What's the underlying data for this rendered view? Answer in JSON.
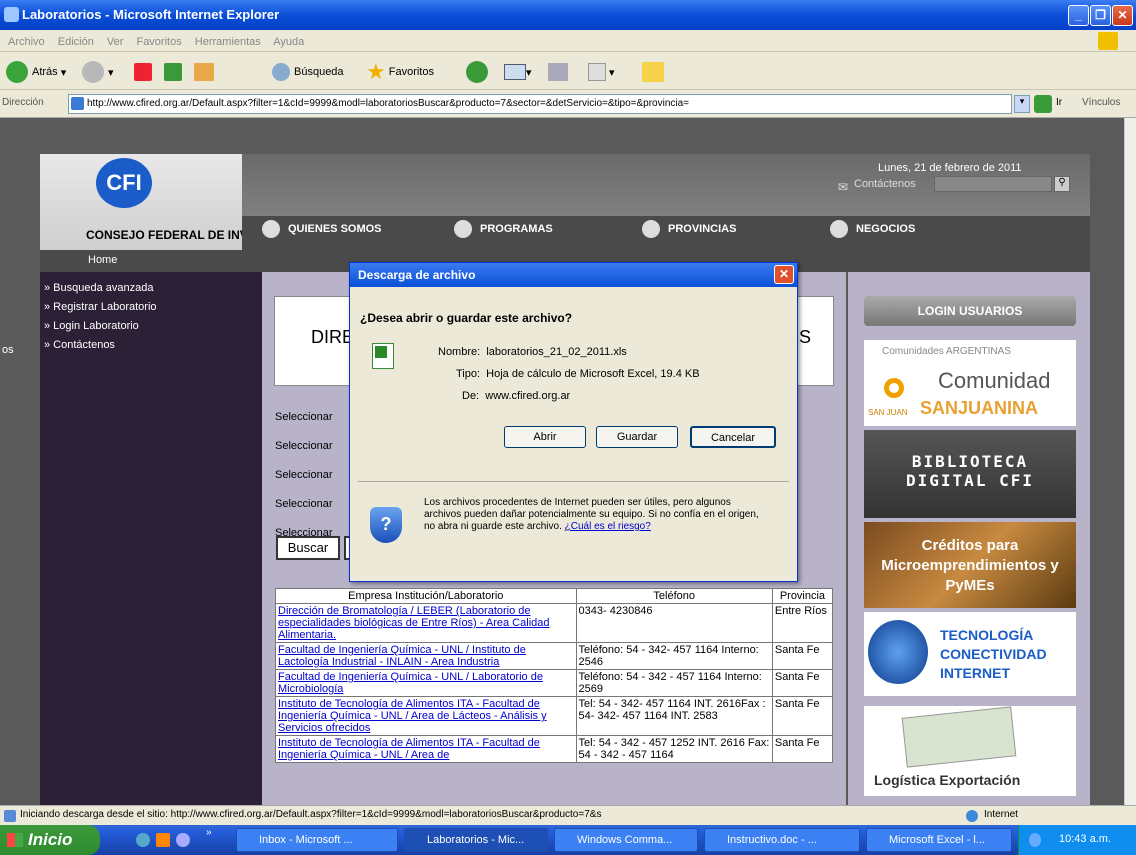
{
  "window": {
    "title": "Laboratorios - Microsoft Internet Explorer"
  },
  "menu": [
    "Archivo",
    "Edición",
    "Ver",
    "Favoritos",
    "Herramientas",
    "Ayuda"
  ],
  "toolbar": {
    "back": "Atrás",
    "search": "Búsqueda",
    "favorites": "Favoritos"
  },
  "address": {
    "label": "Dirección",
    "url": "http://www.cfired.org.ar/Default.aspx?filter=1&cId=9999&modl=laboratoriosBuscar&producto=7&sector=&detServicio=&tipo=&provincia=",
    "go": "Ir",
    "links": "Vínculos"
  },
  "site": {
    "logo": "CFI",
    "org": "CONSEJO FEDERAL DE INVERSIONES",
    "date": "Lunes, 21 de febrero de 2011",
    "contact": "Contáctenos",
    "nav": [
      "QUIENES SOMOS",
      "PROGRAMAS",
      "PROVINCIAS",
      "NEGOCIOS"
    ],
    "home": "Home",
    "sidebar": [
      "» Busqueda avanzada",
      "» Registrar Laboratorio",
      "» Login Laboratorio",
      "» Contáctenos"
    ],
    "sidebar_frag": "os",
    "main_title_left": "DIRE",
    "main_title_right": "S",
    "select_label": "Seleccionar",
    "search_button": "Buscar"
  },
  "table": {
    "headers": [
      "Empresa Institución/Laboratorio",
      "Teléfono",
      "Provincia"
    ],
    "rows": [
      {
        "name": "Dirección de Bromatología / LEBER (Laboratorio de especialidades biológicas de Entre Ríos) - Area Calidad Alimentaria.",
        "phone": "0343- 4230846",
        "prov": "Entre Ríos"
      },
      {
        "name": "Facultad de Ingeniería Química - UNL / Instituto de Lactología Industrial - INLAIN - Area Industria",
        "phone": "Teléfono: 54 - 342- 457 1164 Interno: 2546",
        "prov": "Santa Fe"
      },
      {
        "name": "Facultad de Ingeniería Química - UNL / Laboratorio de Microbiología",
        "phone": "Teléfono: 54 - 342 - 457 1164 Interno: 2569",
        "prov": "Santa Fe"
      },
      {
        "name": "Instituto de Tecnología de Alimentos ITA - Facultad de Ingeniería Química - UNL / Area de Lácteos - Análisis y Servicios ofrecidos",
        "phone": "Tel: 54 - 342- 457 1164 INT. 2616Fax : 54- 342- 457 1164 INT. 2583",
        "prov": "Santa Fe"
      },
      {
        "name": "Instituto de Tecnología de Alimentos ITA - Facultad de Ingeniería Química - UNL / Area de",
        "phone": "Tel: 54 - 342 - 457 1252 INT. 2616 Fax: 54 - 342 - 457 1164",
        "prov": "Santa Fe"
      }
    ]
  },
  "right": {
    "login": "LOGIN USUARIOS",
    "comunidades": "Comunidades ARGENTINAS",
    "comunidad": "Comunidad",
    "sanjuanina": "SANJUANINA",
    "sanjuan": "SAN JUAN",
    "biblioteca1": "BIBLIOTECA",
    "biblioteca2": "DIGITAL CFI",
    "creditos": "Créditos para Microemprendimientos y PyMEs",
    "tec1": "TECNOLOGÍA",
    "tec2": "CONECTIVIDAD",
    "tec3": "INTERNET",
    "logistica": "Logística Exportación"
  },
  "dialog": {
    "title": "Descarga de archivo",
    "question": "¿Desea abrir o guardar este archivo?",
    "name_label": "Nombre:",
    "name": "laboratorios_21_02_2011.xls",
    "type_label": "Tipo:",
    "type": "Hoja de cálculo de Microsoft Excel, 19.4 KB",
    "from_label": "De:",
    "from": "www.cfired.org.ar",
    "open": "Abrir",
    "save": "Guardar",
    "cancel": "Cancelar",
    "warning": "Los archivos procedentes de Internet pueden ser útiles, pero algunos archivos pueden dañar potencialmente su equipo. Si no confía en el origen, no abra ni guarde este archivo.",
    "risk": "¿Cuál es el riesgo?"
  },
  "status": {
    "text": "Iniciando descarga desde el sitio: http://www.cfired.org.ar/Default.aspx?filter=1&cId=9999&modl=laboratoriosBuscar&producto=7&s",
    "zone": "Internet"
  },
  "taskbar": {
    "start": "Inicio",
    "tasks": [
      "Inbox - Microsoft ...",
      "Laboratorios - Mic...",
      "Windows Comma...",
      "Instructivo.doc - ...",
      "Microsoft Excel - l..."
    ],
    "time": "10:43 a.m."
  }
}
